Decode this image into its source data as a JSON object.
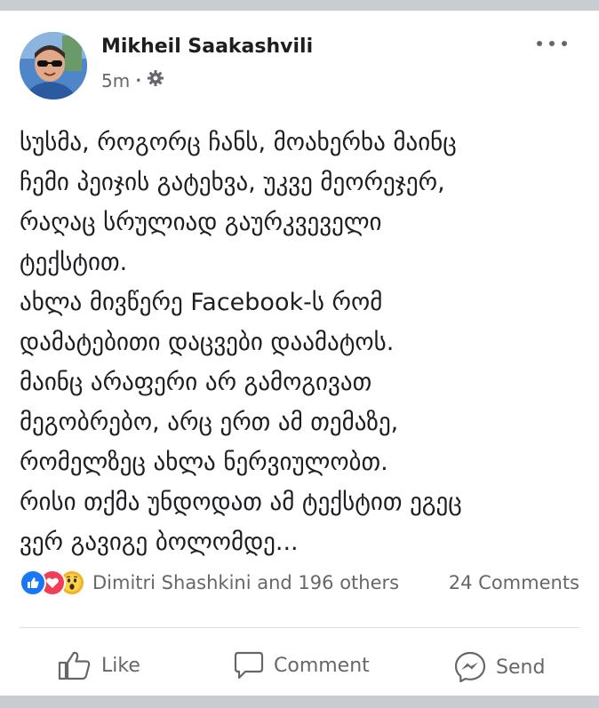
{
  "post": {
    "author": "Mikheil Saakashvili",
    "time": "5m",
    "separator": "•",
    "text": "სუსმა, როგორც ჩანს, მოახერხა მაინც\nჩემი პეიჯის გატეხვა, უკვე მეორეჯერ,\nრაღაც სრულიად გაურკვეველი\nტექსტით.\nახლა მივწერე Facebook-ს რომ\nდამატებითი დაცვები დაამატოს.\nმაინც არაფერი არ გამოგივათ\nმეგობრებო, არც ერთ ამ თემაზე,\nრომელზეც ახლა ნერვიულობთ.\nრისი თქმა უნდოდათ ამ ტექსტით ეგეც\nვერ გავიგე ბოლომდე..."
  },
  "stats": {
    "reactions_text": "Dimitri Shashkini and 196 others",
    "comments_text": "24 Comments"
  },
  "actions": {
    "like": "Like",
    "comment": "Comment",
    "send": "Send"
  },
  "icons": {
    "privacy": "gear-icon",
    "more": "more-options-icon",
    "like_reaction": "like-reaction-icon",
    "love_reaction": "love-reaction-icon",
    "wow_reaction": "wow-reaction-icon"
  },
  "colors": {
    "like_blue": "#1877f2",
    "love_red": "#f33e58",
    "wow_yellow": "#f7b125",
    "secondary_text": "#65676b"
  }
}
